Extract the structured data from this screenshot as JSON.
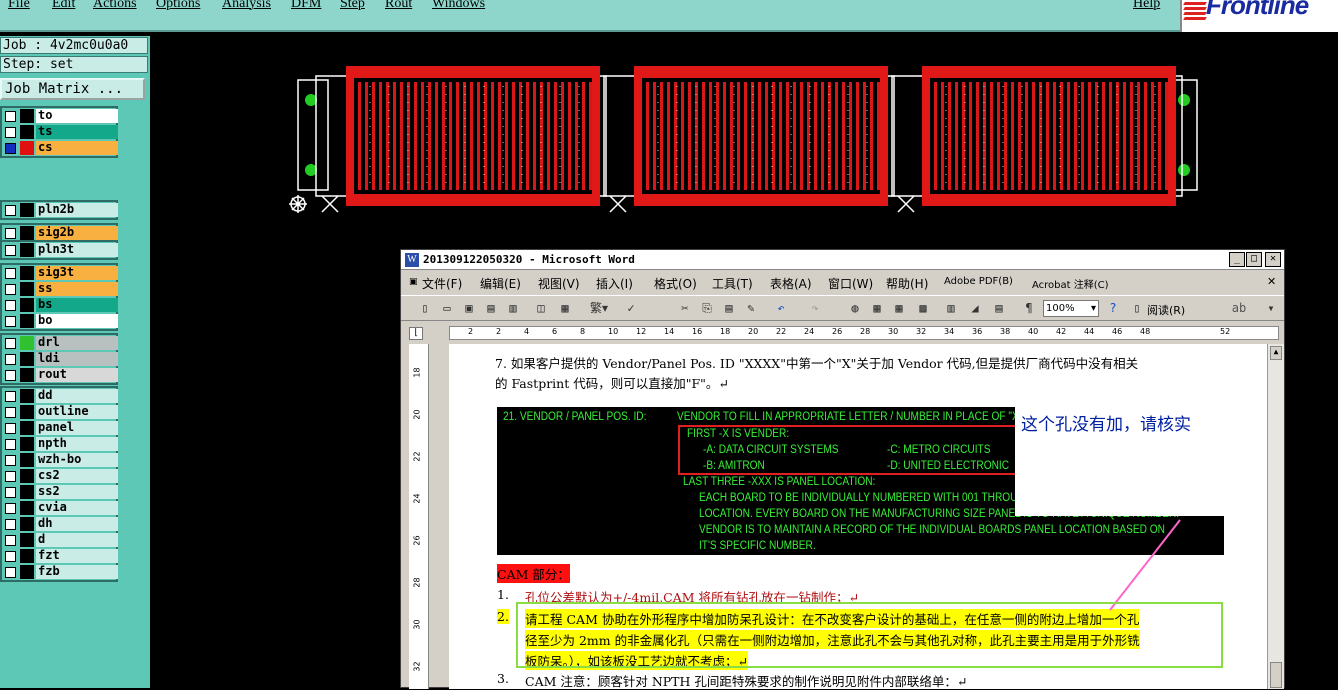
{
  "menubar": {
    "items": [
      "File",
      "Edit",
      "Actions",
      "Options",
      "Analysis",
      "DFM",
      "Step",
      "Rout",
      "Windows"
    ],
    "help": "Help"
  },
  "logo": {
    "text": "Frontline"
  },
  "sidebar": {
    "job": "Job : 4v2mc0u0a0",
    "step": "Step: set",
    "job_matrix": "Job Matrix ...",
    "groups": [
      [
        {
          "name": "to",
          "color": "#ffffff"
        },
        {
          "name": "ts",
          "color": "#14a88a"
        },
        {
          "name": "cs",
          "color": "#f8b040"
        }
      ],
      [
        {
          "name": "pln2b",
          "color": "#c9ece6"
        }
      ],
      [
        {
          "name": "sig2b",
          "color": "#f8b040"
        }
      ],
      [
        {
          "name": "pln3t",
          "color": "#c9ece6"
        }
      ],
      [
        {
          "name": "sig3t",
          "color": "#f8b040"
        },
        {
          "name": "ss",
          "color": "#f8b040"
        },
        {
          "name": "bs",
          "color": "#14a88a"
        },
        {
          "name": "bo",
          "color": "#ffffff"
        }
      ],
      [
        {
          "name": "drl",
          "color": "#b8c0c0"
        },
        {
          "name": "ldi",
          "color": "#b8c0c0"
        },
        {
          "name": "rout",
          "color": "#d8d8d8"
        }
      ],
      [
        {
          "name": "dd",
          "color": "#c9ece6"
        },
        {
          "name": "outline",
          "color": "#c9ece6"
        },
        {
          "name": "panel",
          "color": "#c9ece6"
        },
        {
          "name": "npth",
          "color": "#c9ece6"
        },
        {
          "name": "wzh-bo",
          "color": "#c9ece6"
        },
        {
          "name": "cs2",
          "color": "#c9ece6"
        },
        {
          "name": "ss2",
          "color": "#c9ece6"
        },
        {
          "name": "cvia",
          "color": "#c9ece6"
        },
        {
          "name": "dh",
          "color": "#c9ece6"
        },
        {
          "name": "d",
          "color": "#c9ece6"
        },
        {
          "name": "fzt",
          "color": "#c9ece6"
        },
        {
          "name": "fzb",
          "color": "#c9ece6"
        }
      ]
    ]
  },
  "word": {
    "title": "201309122050320 - Microsoft Word",
    "menu": [
      "文件(F)",
      "编辑(E)",
      "视图(V)",
      "插入(I)",
      "格式(O)",
      "工具(T)",
      "表格(A)",
      "窗口(W)",
      "帮助(H)",
      "Adobe PDF(B)",
      "Acrobat 注释(C)"
    ],
    "zoom": "100%",
    "read_label": "阅读(R)",
    "ruler_ticks": [
      "2",
      "2",
      "4",
      "6",
      "8",
      "10",
      "12",
      "14",
      "16",
      "18",
      "20",
      "22",
      "24",
      "26",
      "28",
      "30",
      "32",
      "34",
      "36",
      "38",
      "40",
      "42",
      "44",
      "46",
      "48",
      "52"
    ],
    "vruler_ticks": [
      "18",
      "20",
      "22",
      "24",
      "26",
      "28",
      "30",
      "32"
    ],
    "para7_line1": "7. 如果客户提供的 Vendor/Panel Pos. ID \"XXXX\"中第一个\"X\"关于加 Vendor 代码,但是提供厂商代码中没有相关",
    "para7_line2": "的 Fastprint 代码，则可以直接加\"F\"。↵",
    "img": {
      "label": "21.  VENDOR / PANEL POS. ID:",
      "line0": "VENDOR TO FILL IN APPROPRIATE LETTER / NUMBER IN PLACE OF \"X\"",
      "line1": "FIRST -X IS VENDER:",
      "line2a": "-A:  DATA CIRCUIT SYSTEMS",
      "line2b": "-C:  METRO CIRCUITS",
      "line3a": "-B:  AMITRON",
      "line3b": "-D:  UNITED ELECTRONIC",
      "line4": "LAST THREE -XXX IS PANEL LOCATION:",
      "line5": "EACH BOARD TO BE  INDIVIDUALLY NUMBERED WITH 001 THROUGH",
      "line6": "LOCATION.  EVERY BOARD ON THE MANUFACTURING SIZE PANEL IS TO HAVE A UNIQUE NUMBER.",
      "line7": "VENDOR IS TO MAINTAIN A RECORD OF THE INDIVIDUAL BOARDS PANEL LOCATION BASED ON",
      "line8": "IT'S SPECIFIC NUMBER."
    },
    "cam_heading": "CAM 部分：",
    "item1_num": "1.",
    "item1": "孔位公差默认为+/-4mil,CAM 将所有钻孔放在一钻制作；↵",
    "item2_num": "2.",
    "item2_l1": "请工程 CAM 协助在外形程序中增加防呆孔设计：在不改变客户设计的基础上，在任意一侧的附边上增加一个孔",
    "item2_l2": "径至少为 2mm 的非金属化孔（只需在一侧附边增加，注意此孔不会与其他孔对称，此孔主要主用是用于外形铣",
    "item2_l3": "板防呆。），如该板没工艺边就不考虑；↵",
    "item3_num": "3.",
    "item3": "CAM 注意：顾客针对 NPTH 孔间距特殊要求的制作说明见附件内部联络单：↵"
  },
  "callout": {
    "text": "这个孔没有加，请核实"
  }
}
